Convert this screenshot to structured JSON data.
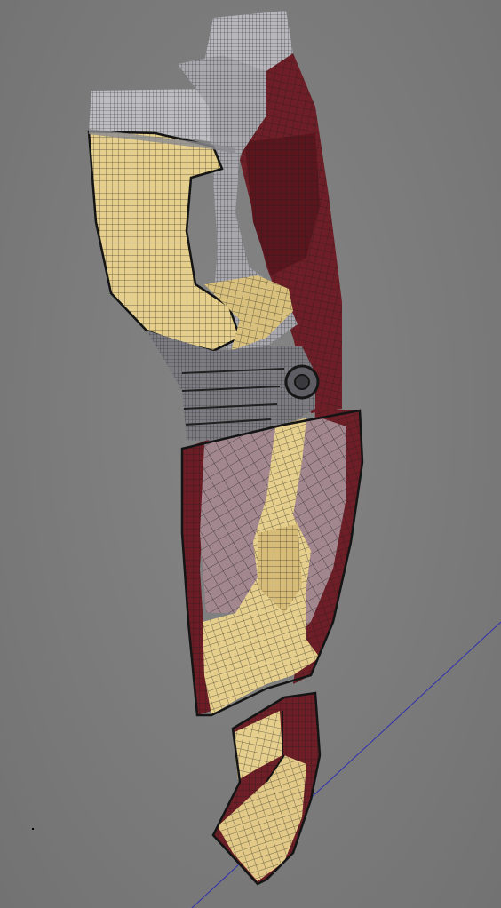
{
  "viewport": {
    "background": "#7a7a7a",
    "model_type": "wireframe-mesh",
    "subject": "armored-leg",
    "colors": {
      "gold": "#e6cf8c",
      "gold_dark": "#c9ae69",
      "red": "#6e1e26",
      "red_dark": "#4e1418",
      "silver": "#b7b7bd",
      "mauve": "#a3878f",
      "wire": "#1c1c1c",
      "axis": "#2f2fb0"
    }
  }
}
